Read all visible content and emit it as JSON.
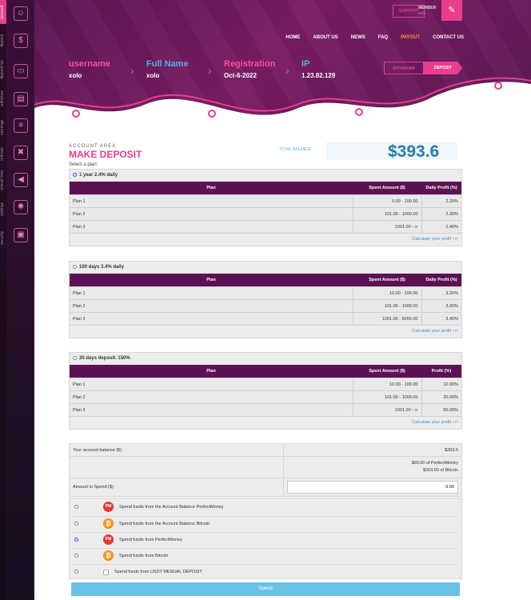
{
  "sidebar": {
    "items": [
      {
        "label": "account",
        "icon": "user-icon"
      },
      {
        "label": "deposit",
        "icon": "coins-icon"
      },
      {
        "label": "deposit list",
        "icon": "monitor-icon"
      },
      {
        "label": "withdraw",
        "icon": "wallet-icon"
      },
      {
        "label": "earnings",
        "icon": "document-icon"
      },
      {
        "label": "referals",
        "icon": "handshake-icon"
      },
      {
        "label": "referal links",
        "icon": "megaphone-icon"
      },
      {
        "label": "settings",
        "icon": "gear-icon"
      },
      {
        "label": "security",
        "icon": "lock-icon"
      }
    ]
  },
  "header": {
    "support_label": "SUPPORT",
    "member_label": "MEMBER",
    "member_name": "xolo",
    "nav": [
      "HOME",
      "ABOUT US",
      "NEWS",
      "FAQ",
      "PAYOUT",
      "CONTACT US"
    ],
    "info": [
      {
        "key": "username",
        "value": "xolo"
      },
      {
        "key": "Full Name",
        "value": "xolo"
      },
      {
        "key": "Registration",
        "value": "Oct-6-2022"
      },
      {
        "key": "IP",
        "value": "1.23.82.129"
      }
    ],
    "withdraw_label": "WITHDRAW",
    "deposit_label": "DEPOSIT"
  },
  "account": {
    "area_label": "ACCOUNT AREA",
    "title": "MAKE DEPOSIT",
    "total_balance_label": "TOTAL BALANCE",
    "total_balance": "$393.6",
    "select_plan_label": "Select a plan:"
  },
  "plans": [
    {
      "name": "1 year 2.4% daily",
      "selected": true,
      "headers": [
        "Plan",
        "Spent Amount ($)",
        "Daily Profit (%)"
      ],
      "rows": [
        [
          "Plan 1",
          "0.00 - 100.00",
          "2.20%"
        ],
        [
          "Plan 2",
          "101.00 - 1000.00",
          "2.30%"
        ],
        [
          "Plan 3",
          "1001.00 - ∞",
          "2.40%"
        ]
      ],
      "calc_label": "Calculate your profit >>"
    },
    {
      "name": "100 days 3.4% daily",
      "selected": false,
      "headers": [
        "Plan",
        "Spent Amount ($)",
        "Daily Profit (%)"
      ],
      "rows": [
        [
          "Plan 1",
          "10.00 - 100.00",
          "3.20%"
        ],
        [
          "Plan 2",
          "101.00 - 1000.00",
          "3.30%"
        ],
        [
          "Plan 3",
          "1001.00 - 5000.00",
          "3.40%"
        ]
      ],
      "calc_label": "Calculate your profit >>"
    },
    {
      "name": "30 days deposit. 150%",
      "selected": false,
      "headers": [
        "Plan",
        "Spent Amount ($)",
        "Profit (%)"
      ],
      "rows": [
        [
          "Plan 1",
          "10.00 - 100.00",
          "10.00%"
        ],
        [
          "Plan 2",
          "101.00 - 1000.00",
          "20.00%"
        ],
        [
          "Plan 3",
          "1001.00 - ∞",
          "50.00%"
        ]
      ],
      "calc_label": "Calculate your profit >>"
    }
  ],
  "balance": {
    "label": "Your account balance ($):",
    "value": "$393.6",
    "detail_pm": "$90.00 of PerfectMoney",
    "detail_btc": "$303.60 of Bitcoin",
    "amount_label": "Amount to Spend ($):",
    "amount_value": "0.00"
  },
  "funds": [
    {
      "icon": "perfectmoney-icon",
      "glyph": "PM",
      "label": "Spend funds from the Account Balance PerfectMoney",
      "selected": false
    },
    {
      "icon": "bitcoin-icon",
      "glyph": "₿",
      "label": "Spend funds from the Account Balance Bitcoin",
      "selected": false
    },
    {
      "icon": "perfectmoney-icon",
      "glyph": "PM",
      "label": "Spend funds from PerfectMoney",
      "selected": true
    },
    {
      "icon": "bitcoin-icon",
      "glyph": "₿",
      "label": "Spend funds from Bitcoin",
      "selected": false
    },
    {
      "icon": "broken-image-icon",
      "glyph": "",
      "label": "Spend funds from USDT MENUAL DEPOSIT",
      "selected": false
    }
  ],
  "spend_label": "Spend",
  "colors": {
    "accent": "#e83e8c",
    "header": "#6a1a5e",
    "table_header": "#5b1154",
    "balance": "#1e7db5",
    "link": "#3c8fd0",
    "button": "#6ac1e6"
  }
}
